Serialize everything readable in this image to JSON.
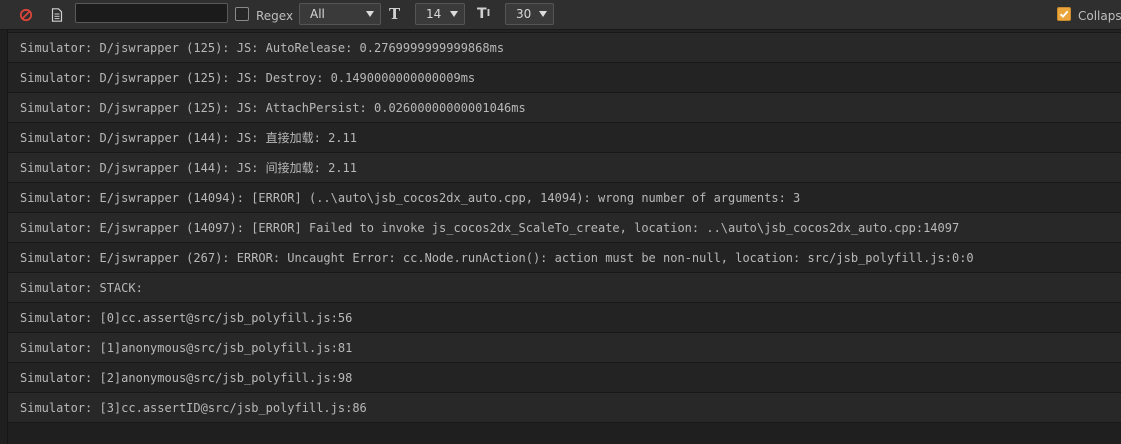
{
  "toolbar": {
    "clear_icon": "no-entry-icon",
    "open_log_icon": "document-icon",
    "search_value": "",
    "regex_label": "Regex",
    "regex_checked": false,
    "level_select": "All",
    "font_icon": "font-size-icon",
    "font_size": "14",
    "line_height_icon": "line-height-icon",
    "line_count": "30",
    "collapse_label": "Collapse",
    "collapse_checked": true
  },
  "colors": {
    "accent": "#eaa63d",
    "clear_icon": "#d9443a"
  },
  "log": {
    "rows": [
      "Simulator: D/jswrapper (125): JS: AutoRelease: 0.2769999999999868ms",
      "Simulator: D/jswrapper (125): JS: Destroy: 0.1490000000000009ms",
      "Simulator: D/jswrapper (125): JS: AttachPersist: 0.02600000000001046ms",
      "Simulator: D/jswrapper (144): JS: 直接加载:  2.11",
      "Simulator: D/jswrapper (144): JS: 间接加载:  2.11",
      "Simulator: E/jswrapper (14094): [ERROR] (..\\auto\\jsb_cocos2dx_auto.cpp, 14094): wrong number of arguments: 3",
      "Simulator: E/jswrapper (14097): [ERROR] Failed to invoke js_cocos2dx_ScaleTo_create, location: ..\\auto\\jsb_cocos2dx_auto.cpp:14097",
      "Simulator: E/jswrapper (267): ERROR: Uncaught Error: cc.Node.runAction(): action must be non-null, location: src/jsb_polyfill.js:0:0",
      "Simulator: STACK:",
      "Simulator: [0]cc.assert@src/jsb_polyfill.js:56",
      "Simulator: [1]anonymous@src/jsb_polyfill.js:81",
      "Simulator: [2]anonymous@src/jsb_polyfill.js:98",
      "Simulator: [3]cc.assertID@src/jsb_polyfill.js:86"
    ]
  }
}
